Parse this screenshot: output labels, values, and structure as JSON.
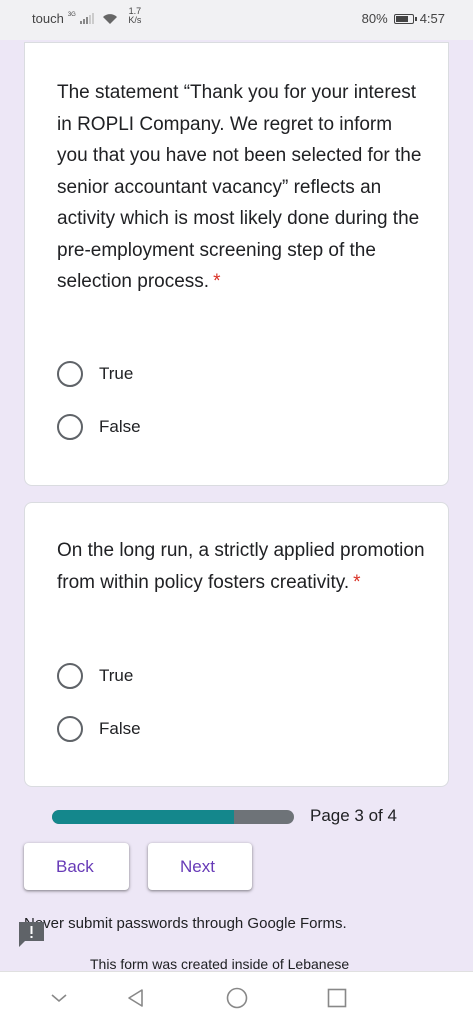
{
  "status_bar": {
    "carrier": "touch",
    "network": "3G",
    "speed_top": "1.7",
    "speed_bottom": "K/s",
    "battery": "80%",
    "battery_level": 0.8,
    "time": "4:57"
  },
  "questions": [
    {
      "text": "The statement “Thank you for your interest in ROPLI Company. We regret to inform you that you have not been selected for the senior accountant vacancy” reflects an activity which is most likely done during the pre-employment screening step of the selection process.",
      "required_mark": "*",
      "options": [
        "True",
        "False"
      ]
    },
    {
      "text": "On the long run, a strictly applied promotion from within policy fosters creativity.",
      "required_mark": "*",
      "options": [
        "True",
        "False"
      ]
    }
  ],
  "progress": {
    "page_label": "Page 3 of 4",
    "fraction": 0.75
  },
  "buttons": {
    "back": "Back",
    "next": "Next"
  },
  "footer": {
    "warning": "Never submit passwords through Google Forms.",
    "created": "This form was created inside of Lebanese"
  },
  "colors": {
    "background": "#ede7f6",
    "accent": "#673ab7",
    "progress_fill": "#14878c",
    "required": "#d93025"
  },
  "icons": {
    "feedback": "feedback-icon",
    "nav_down": "chevron-down-icon",
    "nav_back": "back-triangle-icon",
    "nav_home": "home-circle-icon",
    "nav_recents": "recents-square-icon"
  }
}
